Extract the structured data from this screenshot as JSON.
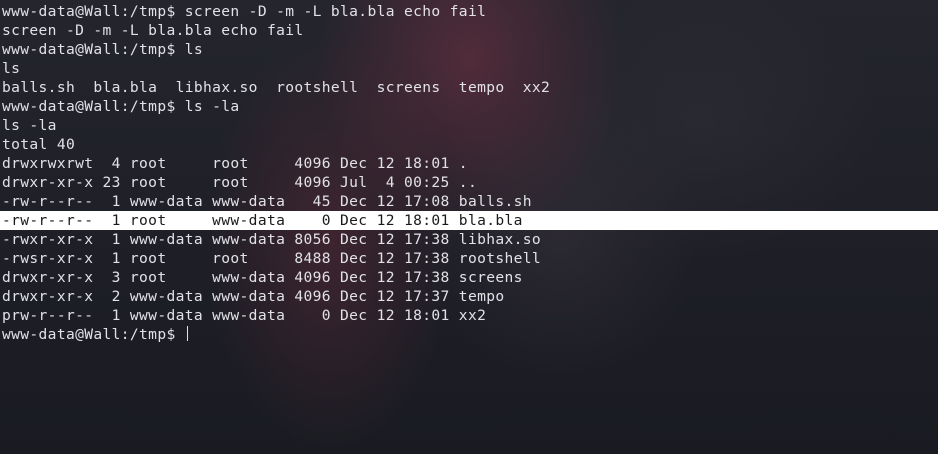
{
  "terminal": {
    "lines": [
      "www-data@Wall:/tmp$ screen -D -m -L bla.bla echo fail",
      "screen -D -m -L bla.bla echo fail",
      "www-data@Wall:/tmp$ ls",
      "ls",
      "balls.sh  bla.bla  libhax.so  rootshell  screens  tempo  xx2",
      "www-data@Wall:/tmp$ ls -la",
      "ls -la",
      "total 40",
      "drwxrwxrwt  4 root     root     4096 Dec 12 18:01 .",
      "drwxr-xr-x 23 root     root     4096 Jul  4 00:25 ..",
      "-rw-r--r--  1 www-data www-data   45 Dec 12 17:08 balls.sh",
      "-rw-r--r--  1 root     www-data    0 Dec 12 18:01 bla.bla",
      "-rwxr-xr-x  1 www-data www-data 8056 Dec 12 17:38 libhax.so",
      "-rwsr-xr-x  1 root     root     8488 Dec 12 17:38 rootshell",
      "drwxr-xr-x  3 root     www-data 4096 Dec 12 17:38 screens",
      "drwxr-xr-x  2 www-data www-data 4096 Dec 12 17:37 tempo",
      "prw-r--r--  1 www-data www-data    0 Dec 12 18:01 xx2"
    ],
    "prompt": "www-data@Wall:/tmp$ ",
    "highlighted_line_index": 11
  },
  "colors": {
    "background": "#1b1c24",
    "text": "#e2e2e6",
    "highlight_bg": "#ffffff",
    "highlight_text": "#1a1a1a"
  }
}
